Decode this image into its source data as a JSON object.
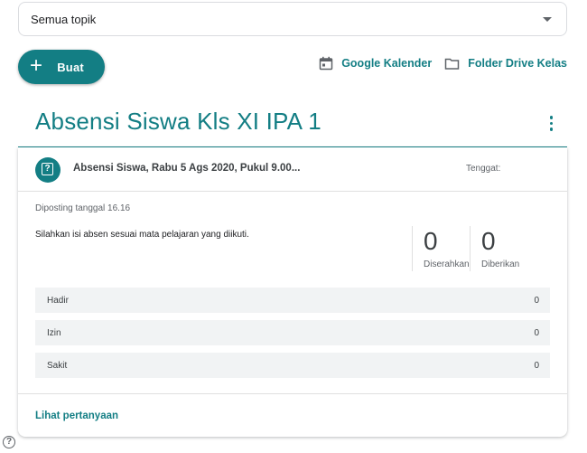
{
  "topic_filter": {
    "value": "Semua topik"
  },
  "create_button": {
    "label": "Buat",
    "icon": "plus-icon"
  },
  "links": {
    "calendar": {
      "label": "Google Kalender",
      "icon": "calendar-icon"
    },
    "drive_folder": {
      "label": "Folder Drive Kelas",
      "icon": "folder-icon"
    }
  },
  "topic": {
    "title": "Absensi Siswa Kls XI IPA 1"
  },
  "post": {
    "title": "Absensi Siswa, Rabu 5 Ags 2020, Pukul 9.00...",
    "due_label": "Tenggat:",
    "posted": "Diposting tanggal 16.16",
    "description": "Silahkan isi absen sesuai mata pelajaran yang diikuti.",
    "stats": [
      {
        "value": "0",
        "label": "Diserahkan"
      },
      {
        "value": "0",
        "label": "Diberikan"
      }
    ],
    "options": [
      {
        "label": "Hadir",
        "count": "0"
      },
      {
        "label": "Izin",
        "count": "0"
      },
      {
        "label": "Sakit",
        "count": "0"
      }
    ],
    "view_link": "Lihat pertanyaan"
  },
  "help_icon": "help-icon",
  "colors": {
    "accent": "#137e84",
    "row_bg": "#f1f3f4",
    "border": "#dadce0"
  }
}
